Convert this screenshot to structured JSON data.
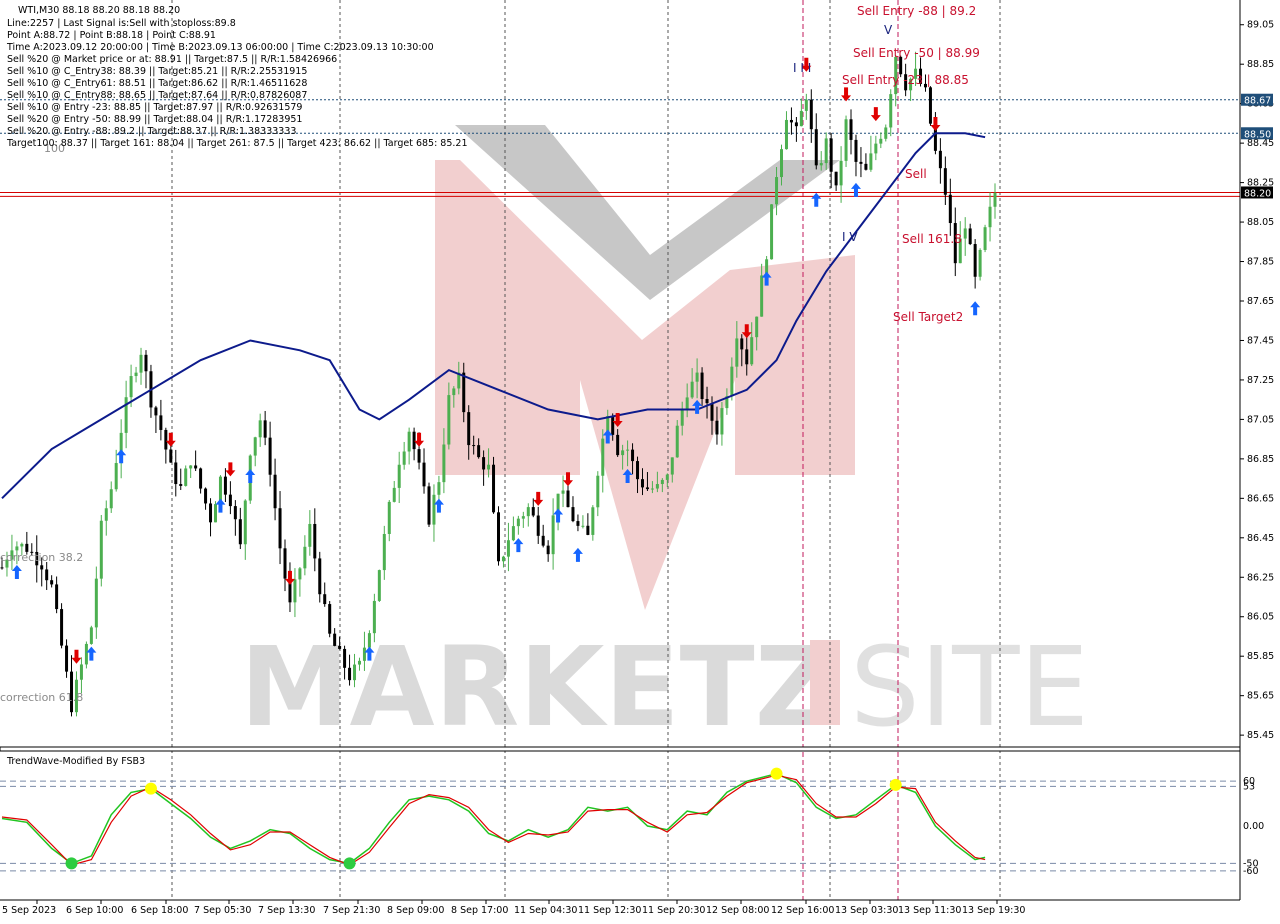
{
  "header": {
    "title": "WTI,M30  88.18 88.20 88.18 88.20",
    "info_lines": [
      "Line:2257 | Last Signal is:Sell with stoploss:89.8",
      "Point A:88.72 | Point B:88.18 | Point C:88.91",
      "Time A:2023.09.12 20:00:00 | Time B:2023.09.13 06:00:00 | Time C:2023.09.13 10:30:00",
      "Sell %20 @ Market price or at: 88.91 || Target:87.5 || R/R:1.58426966",
      "Sell %10 @ C_Entry38: 88.39 || Target:85.21 || R/R:2.25531915",
      "Sell %10 @ C_Entry61: 88.51 || Target:86.62 || R/R:1.46511628",
      "Sell %10 @ C_Entry88: 88.65 || Target:87.64 || R/R:0.87826087",
      "Sell %10 @ Entry -23: 88.85 || Target:87.97 || R/R:0.92631579",
      "Sell %20 @ Entry -50: 88.99 || Target:88.04 || R/R:1.17283951",
      "Sell %20 @ Entry -88: 89.2 || Target:88.37 || R/R:1.38333333",
      "Target100: 88.37 || Target 161: 88.04 || Target 261: 87.5 || Target 423: 86.62 || Target 685: 85.21"
    ]
  },
  "watermark": {
    "text_left": "MARKETZ",
    "text_right": "SITE"
  },
  "annotations": {
    "sell_entry_88": "Sell Entry -88 | 89.2",
    "sell_entry_50": "Sell Entry -50 | 88.99",
    "sell_entry_23": "Sell Entry -23 | 88.85",
    "sell_label": "Sell",
    "sell_161": "Sell 161.8",
    "sell_target": "Sell Target2",
    "correction_38": "correction 38.2",
    "correction_61": "correction 61.8",
    "hundred_label": "100",
    "wave_marks": "I I I",
    "wave_iv": "I V",
    "wave_v": "V"
  },
  "price_axis": {
    "ticks": [
      "89.05",
      "88.85",
      "88.65",
      "88.45",
      "88.25",
      "88.05",
      "87.85",
      "87.65",
      "87.45",
      "87.25",
      "87.05",
      "86.85",
      "86.65",
      "86.45",
      "86.25",
      "86.05",
      "85.85",
      "85.65",
      "85.45"
    ],
    "badges": [
      {
        "label": "88.67",
        "color": "#1f4e79"
      },
      {
        "label": "88.50",
        "color": "#1f4e79"
      },
      {
        "label": "88.20",
        "color": "#000000"
      }
    ]
  },
  "time_axis": {
    "labels": [
      "5 Sep 2023",
      "6 Sep 10:00",
      "6 Sep 18:00",
      "7 Sep 05:30",
      "7 Sep 13:30",
      "7 Sep 21:30",
      "8 Sep 09:00",
      "8 Sep 17:00",
      "11 Sep 04:30",
      "11 Sep 12:30",
      "11 Sep 20:30",
      "12 Sep 08:00",
      "12 Sep 16:00",
      "13 Sep 03:30",
      "13 Sep 11:30",
      "13 Sep 19:30"
    ]
  },
  "indicator": {
    "title": "TrendWave-Modified By FSB3",
    "ticks": [
      "60",
      "53",
      "0.00",
      "-50",
      "-60"
    ]
  },
  "colors": {
    "bull": "#4caf50",
    "bear": "#000000",
    "ma": "#0d1b8c",
    "red_level": "#d40000",
    "blue_level": "#1f4e79",
    "osc_green": "#21c521",
    "osc_red": "#e00000",
    "dot": "#ffff00"
  },
  "chart_data": {
    "type": "candlestick",
    "symbol": "WTI",
    "timeframe": "M30",
    "ylim": [
      85.4,
      89.15
    ],
    "last_price": 88.2,
    "levels": [
      {
        "value": 88.67,
        "style": "dotted",
        "color": "#1f4e79"
      },
      {
        "value": 88.5,
        "style": "dotted",
        "color": "#1f4e79"
      },
      {
        "value": 88.2,
        "style": "solid",
        "color": "#d40000"
      },
      {
        "value": 88.18,
        "style": "solid",
        "color": "#d40000"
      }
    ],
    "close_path": [
      [
        0,
        86.3
      ],
      [
        2,
        86.42
      ],
      [
        5,
        86.4
      ],
      [
        8,
        86.32
      ],
      [
        10,
        86.2
      ],
      [
        12,
        85.9
      ],
      [
        14,
        85.6
      ],
      [
        16,
        85.8
      ],
      [
        18,
        86.0
      ],
      [
        20,
        86.5
      ],
      [
        22,
        86.7
      ],
      [
        24,
        87.0
      ],
      [
        26,
        87.25
      ],
      [
        28,
        87.4
      ],
      [
        30,
        87.15
      ],
      [
        32,
        87.0
      ],
      [
        34,
        86.8
      ],
      [
        36,
        86.7
      ],
      [
        38,
        86.85
      ],
      [
        40,
        86.7
      ],
      [
        42,
        86.55
      ],
      [
        44,
        86.75
      ],
      [
        46,
        86.65
      ],
      [
        48,
        86.4
      ],
      [
        50,
        86.9
      ],
      [
        52,
        87.05
      ],
      [
        54,
        86.8
      ],
      [
        56,
        86.4
      ],
      [
        58,
        86.1
      ],
      [
        60,
        86.3
      ],
      [
        62,
        86.5
      ],
      [
        64,
        86.2
      ],
      [
        66,
        85.95
      ],
      [
        68,
        85.85
      ],
      [
        70,
        85.75
      ],
      [
        72,
        85.8
      ],
      [
        74,
        86.0
      ],
      [
        76,
        86.3
      ],
      [
        78,
        86.6
      ],
      [
        80,
        86.85
      ],
      [
        82,
        87.0
      ],
      [
        84,
        86.8
      ],
      [
        86,
        86.55
      ],
      [
        88,
        86.75
      ],
      [
        90,
        87.15
      ],
      [
        92,
        87.25
      ],
      [
        94,
        86.95
      ],
      [
        96,
        86.85
      ],
      [
        98,
        86.8
      ],
      [
        100,
        86.3
      ],
      [
        102,
        86.45
      ],
      [
        104,
        86.55
      ],
      [
        106,
        86.6
      ],
      [
        108,
        86.5
      ],
      [
        110,
        86.4
      ],
      [
        112,
        86.7
      ],
      [
        114,
        86.6
      ],
      [
        116,
        86.5
      ],
      [
        118,
        86.45
      ],
      [
        120,
        86.8
      ],
      [
        122,
        87.1
      ],
      [
        124,
        86.9
      ],
      [
        126,
        86.9
      ],
      [
        128,
        86.75
      ],
      [
        130,
        86.7
      ],
      [
        132,
        86.7
      ],
      [
        134,
        86.75
      ],
      [
        136,
        87.0
      ],
      [
        138,
        87.2
      ],
      [
        140,
        87.25
      ],
      [
        142,
        87.1
      ],
      [
        144,
        87.0
      ],
      [
        146,
        87.2
      ],
      [
        148,
        87.5
      ],
      [
        150,
        87.35
      ],
      [
        152,
        87.6
      ],
      [
        154,
        87.9
      ],
      [
        156,
        88.3
      ],
      [
        158,
        88.6
      ],
      [
        160,
        88.5
      ],
      [
        162,
        88.7
      ],
      [
        164,
        88.3
      ],
      [
        166,
        88.45
      ],
      [
        168,
        88.2
      ],
      [
        170,
        88.55
      ],
      [
        172,
        88.35
      ],
      [
        174,
        88.3
      ],
      [
        176,
        88.45
      ],
      [
        178,
        88.55
      ],
      [
        180,
        88.9
      ],
      [
        182,
        88.75
      ],
      [
        184,
        88.8
      ],
      [
        186,
        88.7
      ],
      [
        188,
        88.4
      ],
      [
        190,
        88.2
      ],
      [
        192,
        87.85
      ],
      [
        194,
        88.05
      ],
      [
        196,
        87.75
      ],
      [
        198,
        88.0
      ],
      [
        200,
        88.2
      ]
    ],
    "moving_average": [
      [
        0,
        86.65
      ],
      [
        10,
        86.9
      ],
      [
        20,
        87.05
      ],
      [
        30,
        87.2
      ],
      [
        40,
        87.35
      ],
      [
        50,
        87.45
      ],
      [
        60,
        87.4
      ],
      [
        66,
        87.35
      ],
      [
        72,
        87.1
      ],
      [
        76,
        87.05
      ],
      [
        82,
        87.15
      ],
      [
        90,
        87.3
      ],
      [
        100,
        87.2
      ],
      [
        110,
        87.1
      ],
      [
        120,
        87.05
      ],
      [
        130,
        87.1
      ],
      [
        140,
        87.1
      ],
      [
        150,
        87.2
      ],
      [
        156,
        87.35
      ],
      [
        160,
        87.55
      ],
      [
        166,
        87.8
      ],
      [
        172,
        88.0
      ],
      [
        178,
        88.2
      ],
      [
        184,
        88.4
      ],
      [
        188,
        88.5
      ],
      [
        194,
        88.5
      ],
      [
        198,
        88.48
      ]
    ],
    "indicator_osc": {
      "name": "TrendWave-Modified By FSB3",
      "ylim": [
        -95,
        95
      ],
      "levels": [
        60,
        53,
        -50,
        -60
      ],
      "green": [
        [
          0,
          10
        ],
        [
          5,
          5
        ],
        [
          10,
          -30
        ],
        [
          14,
          -50
        ],
        [
          18,
          -40
        ],
        [
          22,
          15
        ],
        [
          26,
          45
        ],
        [
          30,
          50
        ],
        [
          34,
          30
        ],
        [
          38,
          10
        ],
        [
          42,
          -15
        ],
        [
          46,
          -30
        ],
        [
          50,
          -20
        ],
        [
          54,
          -5
        ],
        [
          58,
          -10
        ],
        [
          62,
          -30
        ],
        [
          66,
          -45
        ],
        [
          70,
          -50
        ],
        [
          74,
          -30
        ],
        [
          78,
          5
        ],
        [
          82,
          35
        ],
        [
          86,
          40
        ],
        [
          90,
          35
        ],
        [
          94,
          20
        ],
        [
          98,
          -10
        ],
        [
          102,
          -20
        ],
        [
          106,
          -5
        ],
        [
          110,
          -15
        ],
        [
          114,
          -5
        ],
        [
          118,
          25
        ],
        [
          122,
          20
        ],
        [
          126,
          25
        ],
        [
          130,
          0
        ],
        [
          134,
          -5
        ],
        [
          138,
          20
        ],
        [
          142,
          15
        ],
        [
          146,
          45
        ],
        [
          150,
          60
        ],
        [
          156,
          70
        ],
        [
          160,
          58
        ],
        [
          164,
          25
        ],
        [
          168,
          10
        ],
        [
          172,
          15
        ],
        [
          176,
          35
        ],
        [
          180,
          55
        ],
        [
          184,
          45
        ],
        [
          188,
          0
        ],
        [
          192,
          -25
        ],
        [
          196,
          -45
        ],
        [
          198,
          -42
        ]
      ],
      "red": [
        [
          0,
          12
        ],
        [
          5,
          8
        ],
        [
          10,
          -25
        ],
        [
          14,
          -52
        ],
        [
          18,
          -45
        ],
        [
          22,
          5
        ],
        [
          26,
          40
        ],
        [
          30,
          52
        ],
        [
          34,
          35
        ],
        [
          38,
          15
        ],
        [
          42,
          -10
        ],
        [
          46,
          -32
        ],
        [
          50,
          -25
        ],
        [
          54,
          -8
        ],
        [
          58,
          -8
        ],
        [
          62,
          -25
        ],
        [
          66,
          -42
        ],
        [
          70,
          -52
        ],
        [
          74,
          -35
        ],
        [
          78,
          -2
        ],
        [
          82,
          30
        ],
        [
          86,
          42
        ],
        [
          90,
          38
        ],
        [
          94,
          25
        ],
        [
          98,
          -5
        ],
        [
          102,
          -22
        ],
        [
          106,
          -10
        ],
        [
          110,
          -12
        ],
        [
          114,
          -8
        ],
        [
          118,
          20
        ],
        [
          122,
          22
        ],
        [
          126,
          22
        ],
        [
          130,
          5
        ],
        [
          134,
          -8
        ],
        [
          138,
          15
        ],
        [
          142,
          18
        ],
        [
          146,
          40
        ],
        [
          150,
          58
        ],
        [
          156,
          68
        ],
        [
          160,
          62
        ],
        [
          164,
          30
        ],
        [
          168,
          12
        ],
        [
          172,
          12
        ],
        [
          176,
          30
        ],
        [
          180,
          52
        ],
        [
          184,
          50
        ],
        [
          188,
          5
        ],
        [
          192,
          -20
        ],
        [
          196,
          -42
        ],
        [
          198,
          -45
        ]
      ],
      "dots": [
        [
          30,
          50
        ],
        [
          70,
          -50
        ],
        [
          156,
          70
        ],
        [
          180,
          55
        ],
        [
          14,
          -50
        ]
      ]
    }
  }
}
